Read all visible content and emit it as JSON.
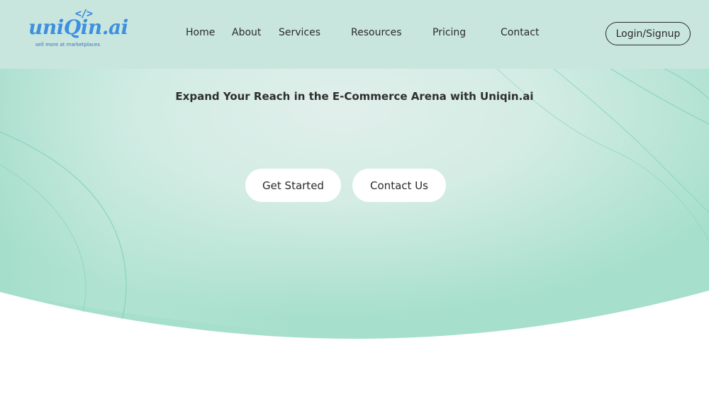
{
  "logo": {
    "code_symbol": "</>",
    "wordmark": "uniQin.ai",
    "tagline": "sell more at marketplaces"
  },
  "nav": {
    "items": [
      {
        "label": "Home"
      },
      {
        "label": "About"
      },
      {
        "label": "Services"
      },
      {
        "label": "Resources"
      },
      {
        "label": "Pricing"
      },
      {
        "label": "Contact"
      }
    ],
    "login_label": "Login/Signup"
  },
  "hero": {
    "headline": "Expand Your Reach in the E-Commerce Arena with Uniqin.ai",
    "get_started_label": "Get Started",
    "contact_us_label": "Contact Us"
  },
  "colors": {
    "header_bg": "#c9e6de",
    "hero_light": "#dcefe9",
    "hero_mint": "#a9e0cf",
    "logo_blue": "#3d8fe0",
    "text_dark": "#2b2b2b"
  }
}
